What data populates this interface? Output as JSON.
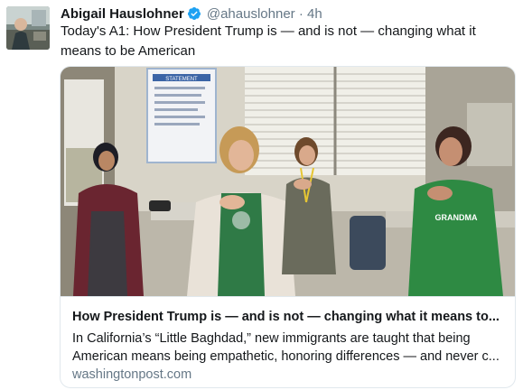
{
  "tweet": {
    "author_name": "Abigail Hauslohner",
    "handle": "@ahauslohner",
    "separator": "·",
    "time": "4h",
    "text": "Today's A1: How President Trump is — and is not — changing what it means to be American",
    "verified_icon": "verified-badge-icon",
    "colors": {
      "verified": "#1da1f2",
      "secondary_text": "#657786",
      "border": "#e1e8ed"
    }
  },
  "card": {
    "title": "How President Trump is — and is not — changing what it means to...",
    "description": "In California’s “Little Baghdad,” new immigrants are taught that being American means being empathetic, honoring differences — and never c...",
    "domain": "washingtonpost.com",
    "image_sign_text": "STATEMENT",
    "shirt_text": "GRANDMA"
  }
}
